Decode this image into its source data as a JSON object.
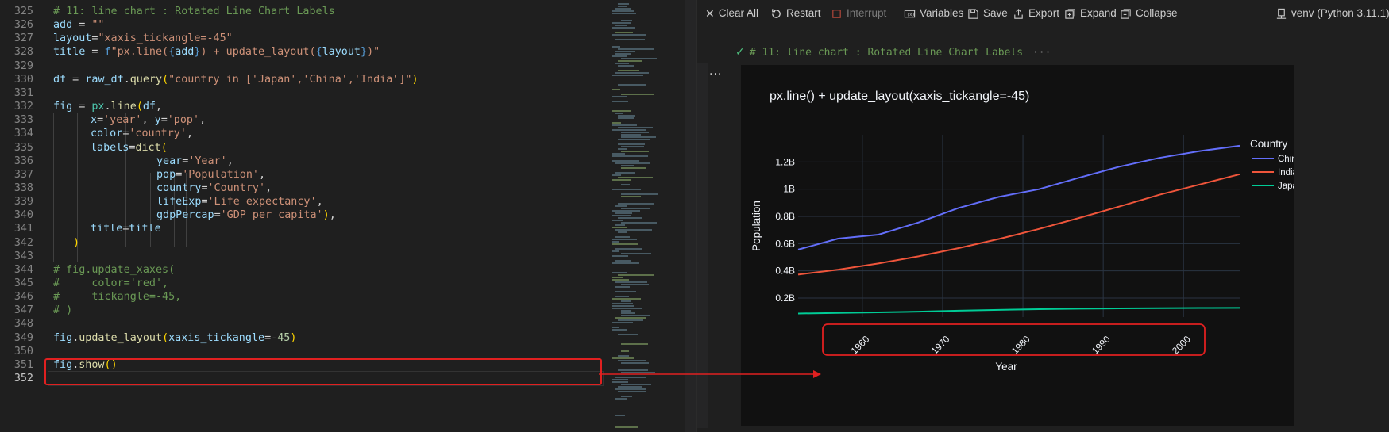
{
  "editor": {
    "lines": [
      {
        "n": "325",
        "text": "# 11: line chart : Rotated Line Chart Labels"
      },
      {
        "n": "326",
        "text": "add = \"\""
      },
      {
        "n": "327",
        "text": "layout=\"xaxis_tickangle=-45\""
      },
      {
        "n": "328",
        "text": "title = f\"px.line({add}) + update_layout({layout})\""
      },
      {
        "n": "329",
        "text": ""
      },
      {
        "n": "330",
        "text": "df = raw_df.query(\"country in ['Japan','China','India']\")"
      },
      {
        "n": "331",
        "text": ""
      },
      {
        "n": "332",
        "text": "fig = px.line(df,"
      },
      {
        "n": "333",
        "text": "x='year', y='pop',"
      },
      {
        "n": "334",
        "text": "color='country',"
      },
      {
        "n": "335",
        "text": "labels=dict("
      },
      {
        "n": "336",
        "text": "year='Year',"
      },
      {
        "n": "337",
        "text": "pop='Population',"
      },
      {
        "n": "338",
        "text": "country='Country',"
      },
      {
        "n": "339",
        "text": "lifeExp='Life expectancy',"
      },
      {
        "n": "340",
        "text": "gdpPercap='GDP per capita'),"
      },
      {
        "n": "341",
        "text": "title=title"
      },
      {
        "n": "342",
        "text": ")"
      },
      {
        "n": "343",
        "text": ""
      },
      {
        "n": "344",
        "text": "# fig.update_xaxes("
      },
      {
        "n": "345",
        "text": "#     color='red',"
      },
      {
        "n": "346",
        "text": "#     tickangle=-45,"
      },
      {
        "n": "347",
        "text": "# )"
      },
      {
        "n": "348",
        "text": ""
      },
      {
        "n": "349",
        "text": "fig.update_layout(xaxis_tickangle=-45)"
      },
      {
        "n": "350",
        "text": ""
      },
      {
        "n": "351",
        "text": "fig.show()"
      },
      {
        "n": "352",
        "text": ""
      }
    ]
  },
  "toolbar": {
    "clear_all": "Clear All",
    "restart": "Restart",
    "interrupt": "Interrupt",
    "variables": "Variables",
    "save": "Save",
    "export": "Export",
    "expand": "Expand",
    "collapse": "Collapse",
    "kernel": "venv (Python 3.11.1)"
  },
  "cell": {
    "header": "# 11: line chart : Rotated Line Chart Labels",
    "ellipsis": "···",
    "more": "···"
  },
  "colors": {
    "china": "#636efa",
    "india": "#ef553b",
    "japan": "#00cc96",
    "highlight": "#e02020"
  },
  "chart_data": {
    "type": "line",
    "title": "px.line() + update_layout(xaxis_tickangle=-45)",
    "xlabel": "Year",
    "ylabel": "Population",
    "legend_title": "Country",
    "legend_position": "top-right",
    "xlim": [
      1952,
      2007
    ],
    "ylim": [
      60000000,
      1400000000
    ],
    "x_ticks": [
      1960,
      1970,
      1980,
      1990,
      2000
    ],
    "x_tick_labels": [
      "1960",
      "1970",
      "1980",
      "1990",
      "2000"
    ],
    "y_ticks": [
      200000000,
      400000000,
      600000000,
      800000000,
      1000000000,
      1200000000
    ],
    "y_tick_labels": [
      "0.2B",
      "0.4B",
      "0.6B",
      "0.8B",
      "1B",
      "1.2B"
    ],
    "x_tickangle": -45,
    "grid": true,
    "x": [
      1952,
      1957,
      1962,
      1967,
      1972,
      1977,
      1982,
      1987,
      1992,
      1997,
      2002,
      2007
    ],
    "series": [
      {
        "name": "China",
        "values": [
          556000000,
          637000000,
          666000000,
          755000000,
          862000000,
          943000000,
          1000000000,
          1084000000,
          1165000000,
          1230000000,
          1280000000,
          1319000000
        ]
      },
      {
        "name": "India",
        "values": [
          372000000,
          409000000,
          454000000,
          506000000,
          567000000,
          634000000,
          708000000,
          788000000,
          872000000,
          959000000,
          1034000000,
          1110000000
        ]
      },
      {
        "name": "Japan",
        "values": [
          86000000,
          91000000,
          95000000,
          100000000,
          107000000,
          113000000,
          118000000,
          122000000,
          124000000,
          125000000,
          127000000,
          127500000
        ]
      }
    ]
  }
}
